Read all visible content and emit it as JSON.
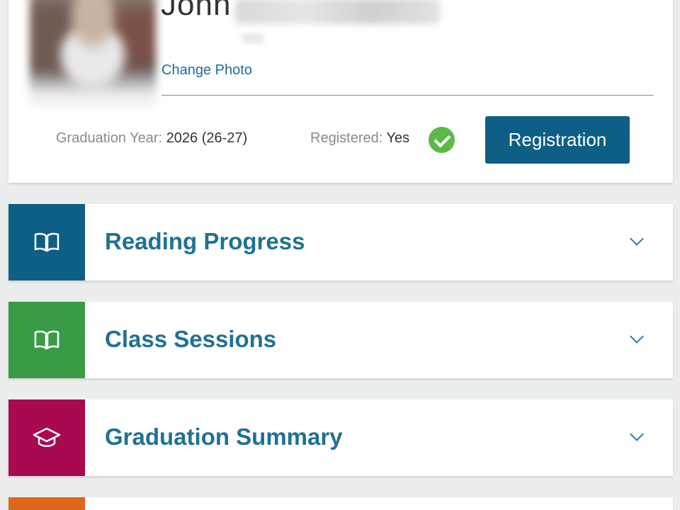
{
  "profile": {
    "first_name": "John",
    "change_photo_label": "Change Photo",
    "graduation_year_label": "Graduation Year:",
    "graduation_year_value": "2026 (26-27)",
    "registered_label": "Registered:",
    "registered_value": "Yes",
    "registered_icon": "check-circle-icon",
    "registration_button_label": "Registration"
  },
  "sections": [
    {
      "label": "Reading Progress",
      "icon": "book-icon",
      "color": "#0e5f86"
    },
    {
      "label": "Class Sessions",
      "icon": "book-icon",
      "color": "#3a9b47"
    },
    {
      "label": "Graduation Summary",
      "icon": "graduation-cap-icon",
      "color": "#a8094f"
    },
    {
      "label": "",
      "icon": "",
      "color": "#e0661a"
    }
  ],
  "colors": {
    "link": "#1a6e9a",
    "primary_button": "#0e5f86",
    "success": "#5cb847",
    "section_title": "#1f7194"
  }
}
